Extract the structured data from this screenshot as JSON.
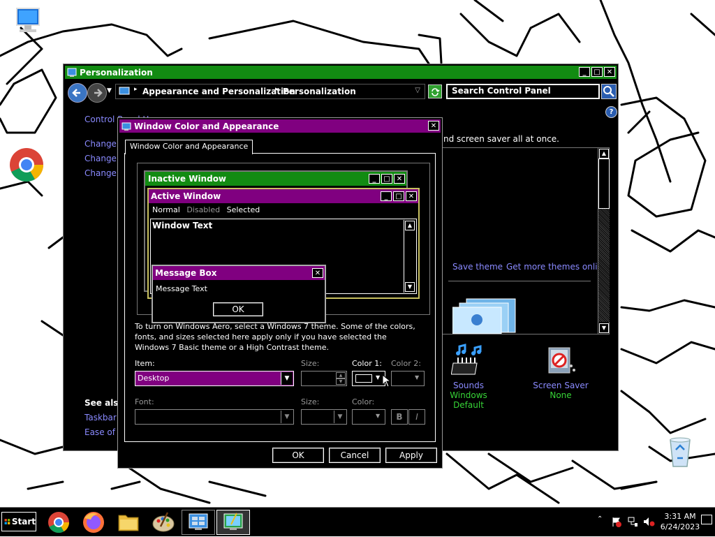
{
  "main_window": {
    "title": "Personalization",
    "breadcrumb": [
      "Appearance and Personalization",
      "Personalization"
    ],
    "search_placeholder": "Search Control Panel",
    "sidebar": {
      "home": "Control Panel Home",
      "link1": "Change desktop icons",
      "link2": "Change mouse pointers",
      "link3": "Change your account picture",
      "see_also": "See also",
      "see_also_1": "Taskbar and Start Menu",
      "see_also_2": "Ease of Access Center"
    },
    "intro_tail": "unds, and screen saver all at once.",
    "save_theme": "Save theme",
    "get_more_themes": "Get more themes online",
    "sounds": {
      "label": "Sounds",
      "value": "Windows Default"
    },
    "screen_saver": {
      "label": "Screen Saver",
      "value": "None"
    }
  },
  "dialog": {
    "title": "Window Color and Appearance",
    "tab": "Window Color and Appearance",
    "preview": {
      "inactive_title": "Inactive Window",
      "active_title": "Active Window",
      "menu": [
        "Normal",
        "Disabled",
        "Selected"
      ],
      "window_text": "Window Text",
      "msgbox_title": "Message Box",
      "msgbox_text": "Message Text",
      "msgbox_ok": "OK"
    },
    "info_text": "To turn on Windows Aero, select a Windows 7 theme.  Some of the colors, fonts, and sizes selected here apply only if you have selected the Windows 7 Basic theme or a High Contrast theme.",
    "item_label": "Item:",
    "item_value": "Desktop",
    "size_label": "Size:",
    "color1_label": "Color 1:",
    "color2_label": "Color 2:",
    "font_label": "Font:",
    "font_size_label": "Size:",
    "font_color_label": "Color:",
    "bold": "B",
    "italic": "I",
    "ok": "OK",
    "cancel": "Cancel",
    "apply": "Apply"
  },
  "taskbar": {
    "start": "Start",
    "time": "3:31 AM",
    "date": "6/24/2023"
  },
  "colors": {
    "title_green": "#128b12",
    "title_purple": "#800080",
    "link": "#8a8aff",
    "green_text": "#37d437"
  }
}
